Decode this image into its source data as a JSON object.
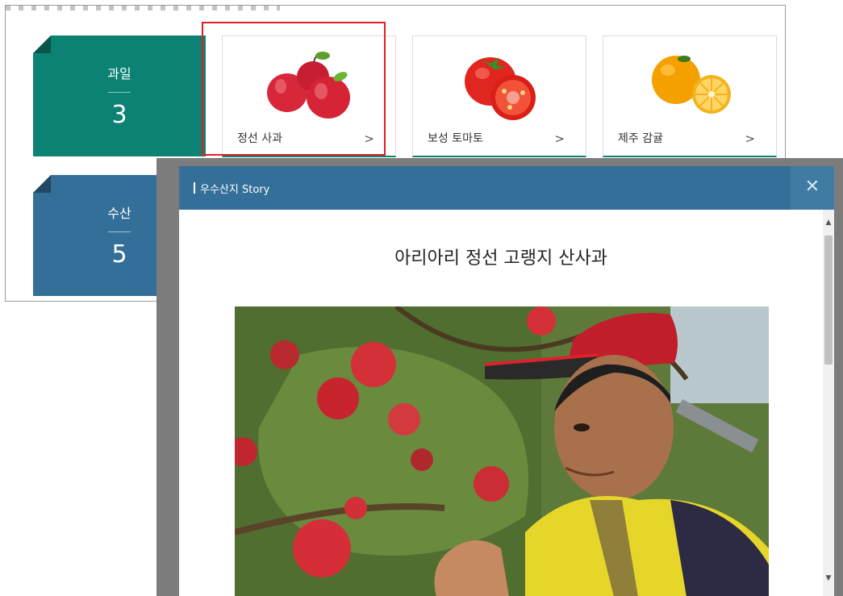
{
  "categories": [
    {
      "name": "과일",
      "count": "3"
    },
    {
      "name": "수산",
      "count": "5"
    }
  ],
  "products": [
    {
      "name": "정선 사과",
      "chevron": ">",
      "icon": "apple-image"
    },
    {
      "name": "보성 토마토",
      "chevron": ">",
      "icon": "tomato-image"
    },
    {
      "name": "제주 감귤",
      "chevron": ">",
      "icon": "tangerine-image"
    }
  ],
  "modal": {
    "header_title": "우수산지 Story",
    "close_label": "✕",
    "heading": "아리아리 정선 고랭지 산사과",
    "scroll_up": "▲",
    "scroll_down": "▼"
  },
  "colors": {
    "fruit_accent": "#0b8273",
    "seafood_accent": "#336f98",
    "selection_outline": "#e02020"
  }
}
